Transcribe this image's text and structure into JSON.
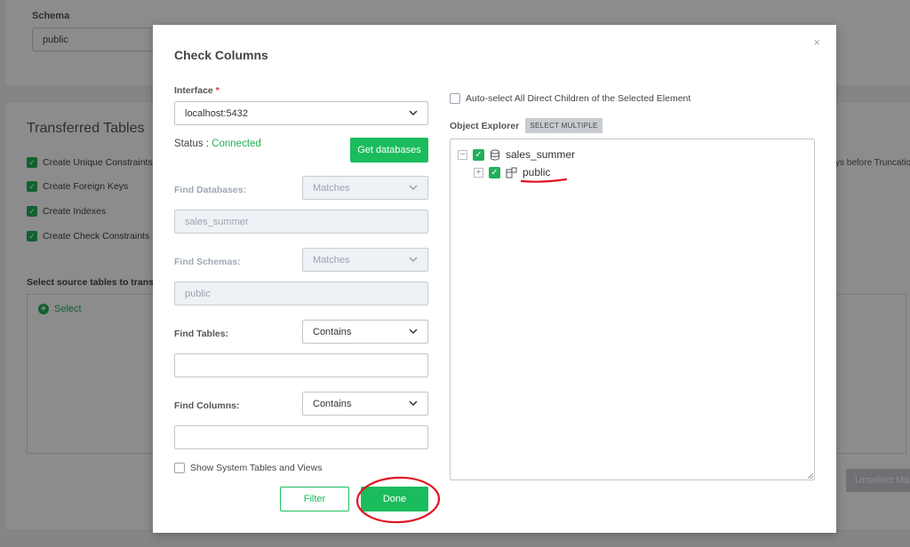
{
  "background": {
    "schema_label": "Schema",
    "schema_value": "public",
    "section_title": "Transferred Tables",
    "checks": [
      "Create Unique Constraints",
      "Create Foreign Keys",
      "Create Indexes",
      "Create Check Constraints"
    ],
    "source_label": "Select source tables to transfer",
    "select_link": "Select",
    "truncate_text": "ys before Truncatio",
    "unselect_button": "Unselect Mas"
  },
  "modal": {
    "title": "Check Columns",
    "close": "×",
    "interface_label": "Interface",
    "required_mark": "*",
    "interface_value": "localhost:5432",
    "status_label": "Status : ",
    "status_value": "Connected",
    "get_databases": "Get databases",
    "find_databases": {
      "label": "Find Databases:",
      "mode": "Matches",
      "value": "sales_summer"
    },
    "find_schemas": {
      "label": "Find Schemas:",
      "mode": "Matches",
      "value": "public"
    },
    "find_tables": {
      "label": "Find Tables:",
      "mode": "Contains",
      "value": ""
    },
    "find_columns": {
      "label": "Find Columns:",
      "mode": "Contains",
      "value": ""
    },
    "show_system": "Show System Tables and Views",
    "filter_button": "Filter",
    "done_button": "Done",
    "auto_select": "Auto-select All Direct Children of the Selected Element",
    "object_explorer": "Object Explorer",
    "select_multiple": "SELECT MULTIPLE",
    "tree": [
      {
        "label": "sales_summer",
        "toggle": "−",
        "icon": "database-icon",
        "checked": true
      },
      {
        "label": "public",
        "toggle": "+",
        "icon": "schema-icon",
        "checked": true
      }
    ]
  },
  "annotation_color": "#e0131f"
}
